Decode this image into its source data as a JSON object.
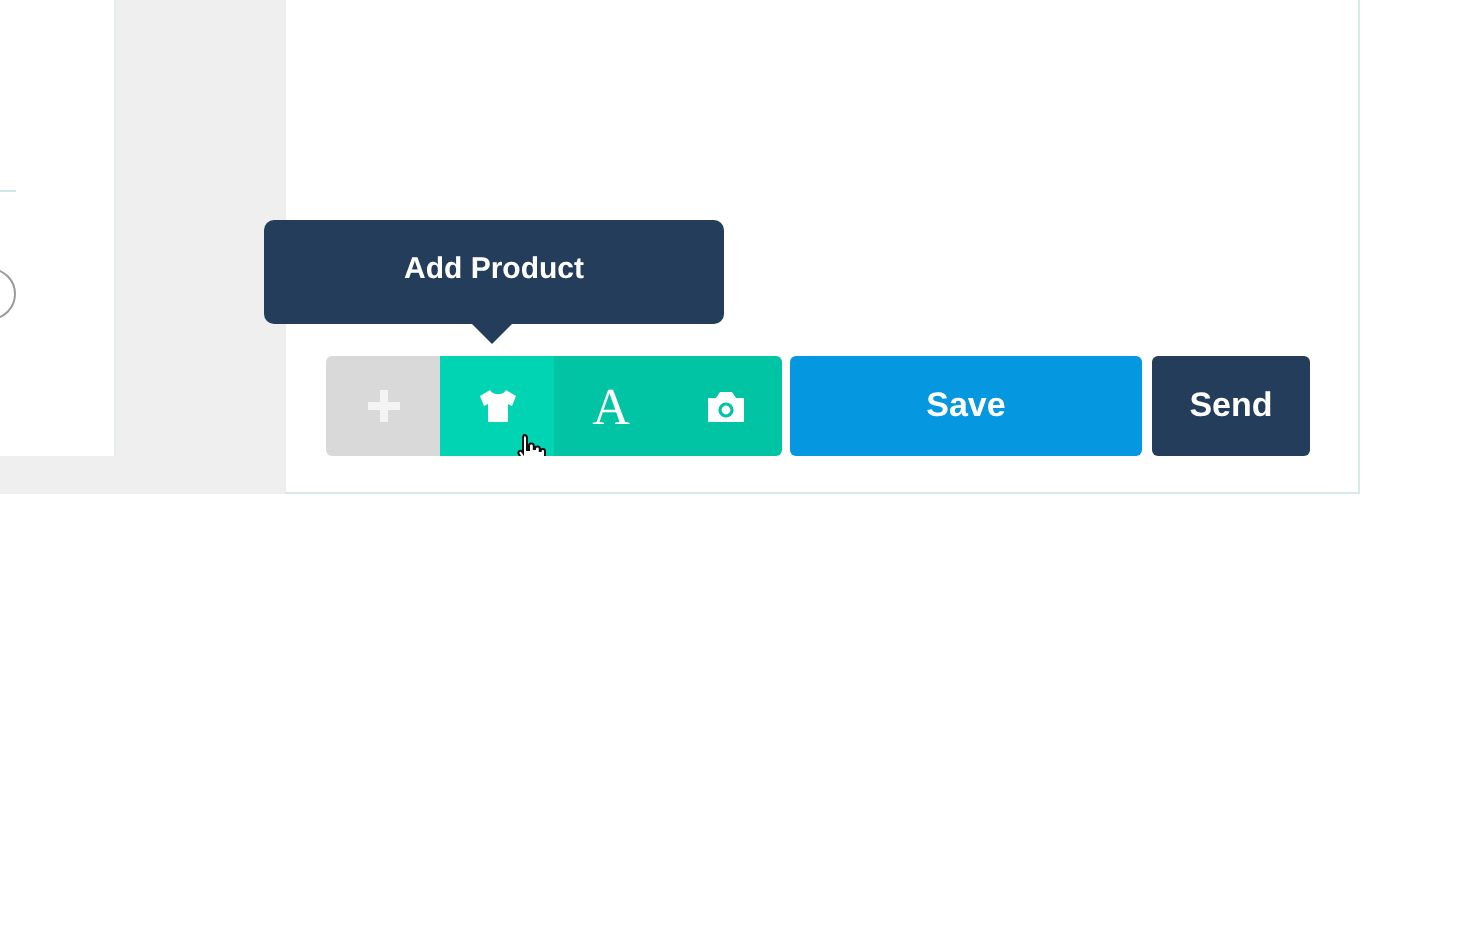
{
  "tooltip": {
    "text": "Add Product"
  },
  "tools": [
    {
      "kind": "add",
      "selected": false
    },
    {
      "kind": "product",
      "selected": true
    },
    {
      "kind": "text",
      "label": "A",
      "selected": false
    },
    {
      "kind": "photo",
      "selected": false
    }
  ],
  "buttons": [
    {
      "kind": "save",
      "label": "Save"
    },
    {
      "kind": "send",
      "label": "Send"
    }
  ]
}
